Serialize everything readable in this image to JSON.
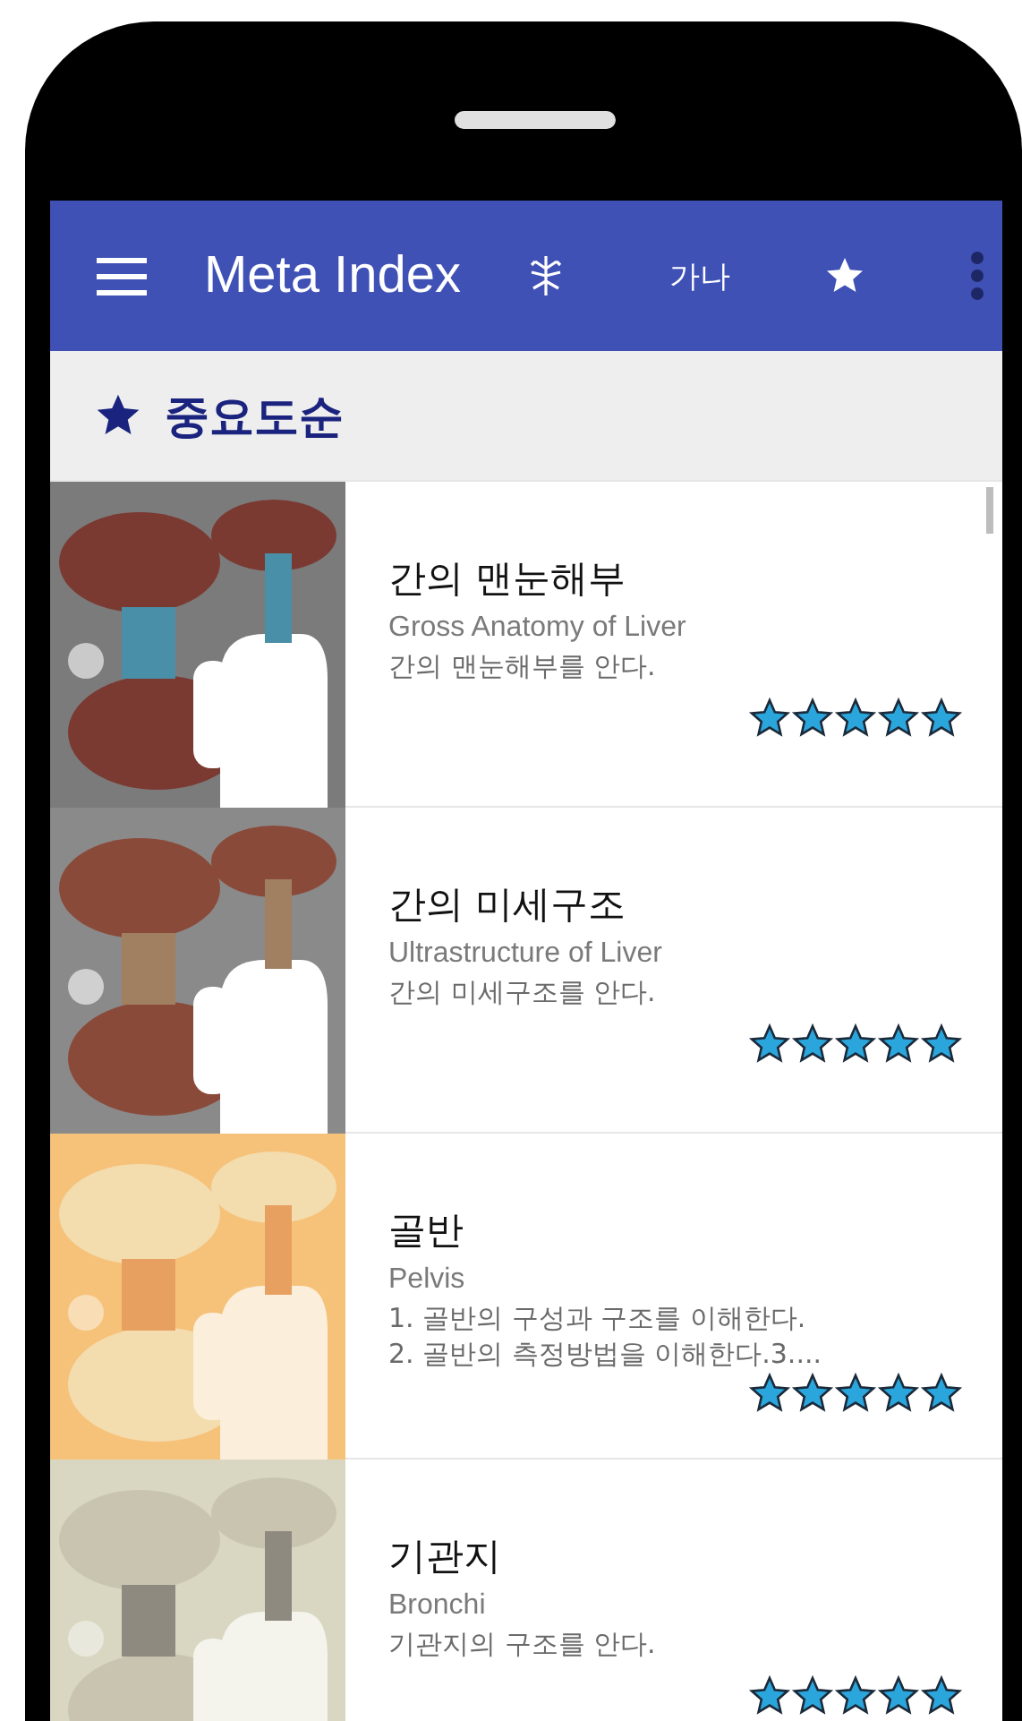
{
  "app_bar": {
    "title": "Meta Index",
    "sort_glyph": "가나"
  },
  "sort_header": {
    "label": "중요도순"
  },
  "items": [
    {
      "title": "간의 맨눈해부",
      "subtitle": "Gross Anatomy of Liver",
      "description": "간의 맨눈해부를 안다.",
      "stars": 5
    },
    {
      "title": "간의 미세구조",
      "subtitle": "Ultrastructure of Liver",
      "description": "간의 미세구조를 안다.",
      "stars": 5
    },
    {
      "title": "골반",
      "subtitle": "Pelvis",
      "description": "1. 골반의 구성과 구조를 이해한다.\n2. 골반의 측정방법을 이해한다.3....",
      "stars": 5
    },
    {
      "title": "기관지",
      "subtitle": "Bronchi",
      "description": "기관지의 구조를 안다.",
      "stars": 5
    }
  ]
}
